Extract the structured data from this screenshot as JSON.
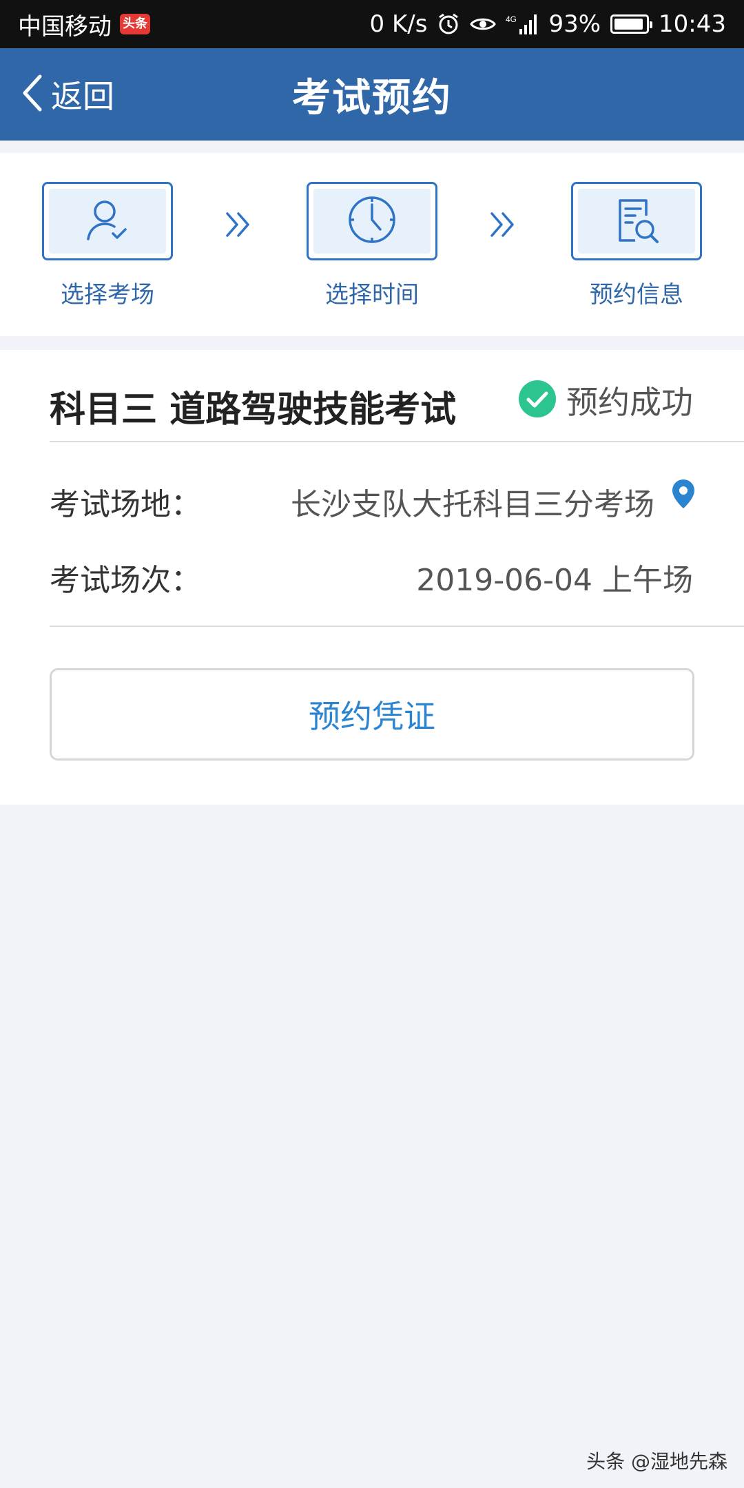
{
  "status_bar": {
    "carrier": "中国移动",
    "news_badge": "头条",
    "speed": "0 K/s",
    "network": "4G",
    "battery": "93%",
    "battery_level": 0.93,
    "time": "10:43"
  },
  "nav": {
    "back_label": "返回",
    "title": "考试预约"
  },
  "steps": [
    {
      "label": "选择考场",
      "icon": "user-check-icon"
    },
    {
      "label": "选择时间",
      "icon": "clock-icon"
    },
    {
      "label": "预约信息",
      "icon": "document-search-icon"
    }
  ],
  "card": {
    "title": "科目三 道路驾驶技能考试",
    "status": "预约成功",
    "status_color": "#2dc58f",
    "venue_label": "考试场地：",
    "venue_value": "长沙支队大托科目三分考场",
    "session_label": "考试场次：",
    "session_value": "2019-06-04 上午场",
    "voucher_button": "预约凭证"
  },
  "watermark": "头条 @湿地先森",
  "colors": {
    "nav_blue": "#2f67a9",
    "accent_blue": "#2f73c6",
    "link_blue": "#2a84d0"
  }
}
